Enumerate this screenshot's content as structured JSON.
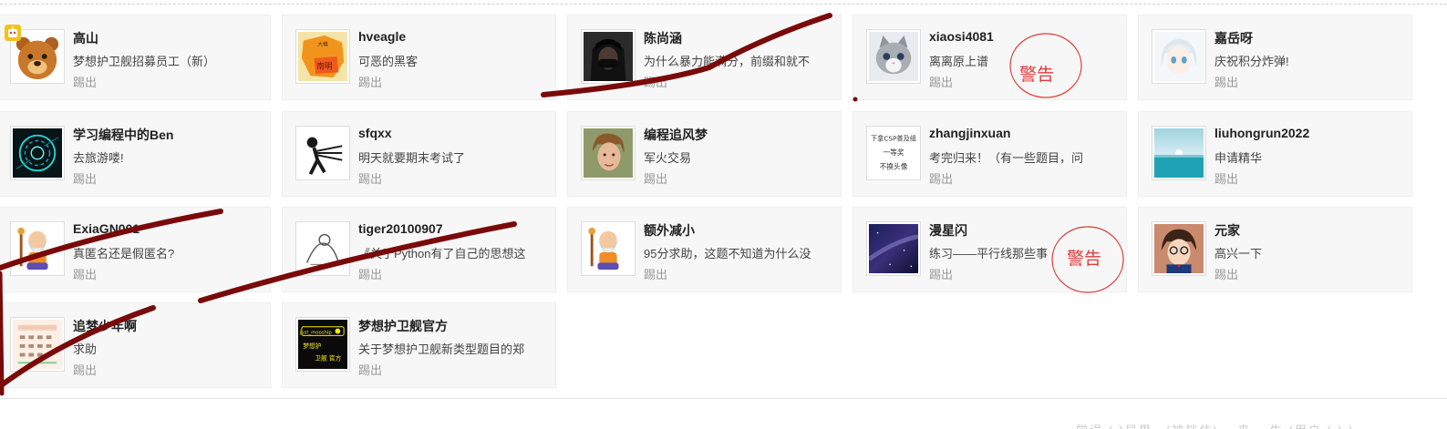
{
  "members": [
    {
      "name": "高山",
      "signature": "梦想护卫舰招募员工（新）",
      "kick": "踢出",
      "avatar_icon": "cartoon-bear-icon"
    },
    {
      "name": "hveagle",
      "signature": "可恶的黑客",
      "kick": "踢出",
      "avatar_icon": "map-icon",
      "avatar_text": {
        "top": "大稽",
        "bottom": "南明"
      }
    },
    {
      "name": "陈尚涵",
      "signature": "为什么暴力能满分，前缀和就不",
      "kick": "踢出",
      "avatar_icon": "masked-person-icon"
    },
    {
      "name": "xiaosi4081",
      "signature": "离离原上谱",
      "kick": "踢出",
      "avatar_icon": "kitten-icon"
    },
    {
      "name": "嘉岳呀",
      "signature": "庆祝积分炸弹!",
      "kick": "踢出",
      "avatar_icon": "anime-character-icon"
    },
    {
      "name": "学习编程中的Ben",
      "signature": "去旅游喽!",
      "kick": "踢出",
      "avatar_icon": "glowing-ring-icon"
    },
    {
      "name": "sfqxx",
      "signature": "明天就要期末考试了",
      "kick": "踢出",
      "avatar_icon": "stick-figure-icon"
    },
    {
      "name": "编程追风梦",
      "signature": "军火交易",
      "kick": "踢出",
      "avatar_icon": "portrait-icon"
    },
    {
      "name": "zhangjinxuan",
      "signature": "考完归来！（有一些题目，问",
      "kick": "踢出",
      "avatar_icon": "text-avatar-icon",
      "avatar_text": {
        "line1": "下拿CSP普及组",
        "line2": "一等奖",
        "line3": "不换头像"
      }
    },
    {
      "name": "liuhongrun2022",
      "signature": "申请精华",
      "kick": "踢出",
      "avatar_icon": "seascape-icon"
    },
    {
      "name": "ExiaGN001",
      "signature": "真匿名还是假匿名?",
      "kick": "踢出",
      "avatar_icon": "old-master-icon"
    },
    {
      "name": "tiger20100907",
      "signature": "《关于Python有了自己的思想这",
      "kick": "踢出",
      "avatar_icon": "sketch-icon"
    },
    {
      "name": "额外减小",
      "signature": "95分求助，这题不知道为什么没",
      "kick": "踢出",
      "avatar_icon": "old-master-icon"
    },
    {
      "name": "漫星闪",
      "signature": "练习——平行线那些事",
      "kick": "踢出",
      "avatar_icon": "galaxy-icon"
    },
    {
      "name": "元家",
      "signature": "高兴一下",
      "kick": "踢出",
      "avatar_icon": "detective-icon"
    },
    {
      "name": "追梦少年啊",
      "signature": "求助",
      "kick": "踢出",
      "avatar_icon": "calendar-icon"
    },
    {
      "name": "梦想护卫舰官方",
      "signature": "关于梦想护卫舰新类型题目的郑",
      "kick": "踢出",
      "avatar_icon": "logo-icon",
      "avatar_text": {
        "top": "just_mooship",
        "mid": "梦想护",
        "bottom": "卫舰 官方"
      }
    }
  ],
  "annotations": {
    "warning_1": "警告",
    "warning_2": "警告"
  },
  "colors": {
    "card_bg": "#f7f7f7",
    "scribble": "#7a0a0a",
    "warning": "#e23b3b",
    "badge": "#f2c21b"
  },
  "footer_faint": "学误 (  )显男…(被挡住)…  来…  生  (用户 (  )  )"
}
